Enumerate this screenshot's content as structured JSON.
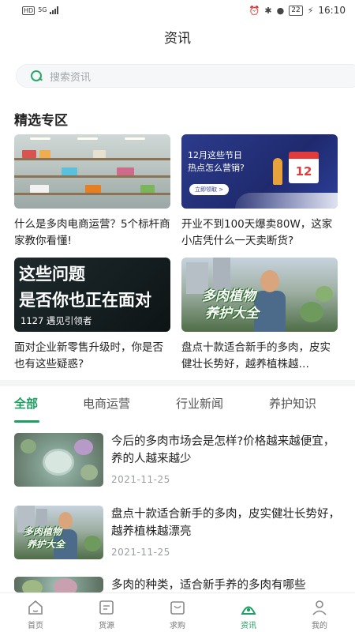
{
  "status_bar": {
    "left_badges": [
      "HD",
      "5G"
    ],
    "battery": "22",
    "time": "16:10",
    "icons": [
      "alarm-icon",
      "bluetooth-icon",
      "location-icon",
      "battery-icon",
      "charging-icon"
    ]
  },
  "header": {
    "title": "资讯"
  },
  "search": {
    "placeholder": "搜索资讯",
    "icon": "search-icon"
  },
  "featured": {
    "title": "精选专区",
    "cards": [
      {
        "title": "什么是多肉电商运营？5个标杆商家教你看懂!"
      },
      {
        "title": "开业不到100天爆卖80W，这家小店凭什么一天卖断货?",
        "banner_line1": "12月这些节日",
        "banner_line2": "热点怎么营销?",
        "banner_button": "立即领取 >",
        "calendar_day": "12"
      },
      {
        "title": "面对企业新零售升级时，你是否也有这些疑惑?",
        "banner_line1": "这些问题",
        "banner_line2": "是否你也正在面对",
        "banner_caption": "1127 遇见引领者"
      },
      {
        "title": "盘点十款适合新手的多肉，皮实健壮长势好，越养植株越…",
        "overlay_line1": "多肉植物",
        "overlay_line2": "养护大全"
      }
    ]
  },
  "tabs": [
    {
      "label": "全部",
      "active": true
    },
    {
      "label": "电商运营",
      "active": false
    },
    {
      "label": "行业新闻",
      "active": false
    },
    {
      "label": "养护知识",
      "active": false
    }
  ],
  "news": [
    {
      "title": "今后的多肉市场会是怎样?价格越来越便宜，养的人越来越少",
      "date": "2021-11-25"
    },
    {
      "title": "盘点十款适合新手的多肉，皮实健壮长势好，越养植株越漂亮",
      "date": "2021-11-25",
      "overlay_line1": "多肉植物",
      "overlay_line2": "养护大全"
    },
    {
      "title": "多肉的种类，适合新手养的多肉有哪些",
      "date": ""
    }
  ],
  "bottom_nav": [
    {
      "label": "首页",
      "icon": "home-icon",
      "active": false
    },
    {
      "label": "货源",
      "icon": "supply-icon",
      "active": false
    },
    {
      "label": "求购",
      "icon": "purchase-icon",
      "active": false
    },
    {
      "label": "资讯",
      "icon": "news-icon",
      "active": true
    },
    {
      "label": "我的",
      "icon": "profile-icon",
      "active": false
    }
  ],
  "colors": {
    "accent": "#1e9e62",
    "search_icon": "#2aa86b",
    "text": "#222222",
    "muted": "#9a9da2"
  }
}
